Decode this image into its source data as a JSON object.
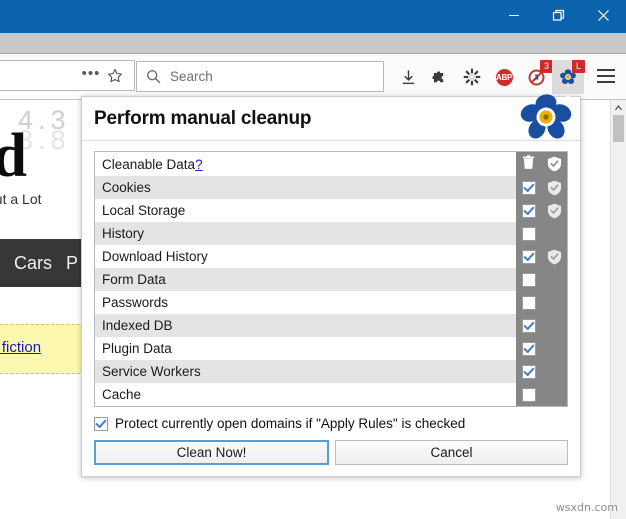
{
  "window": {
    "controls": [
      {
        "name": "minimize",
        "glyph": "minimize-icon"
      },
      {
        "name": "restore",
        "glyph": "restore-icon"
      },
      {
        "name": "close",
        "glyph": "close-icon"
      }
    ],
    "titlebar_color": "#0b63ad"
  },
  "toolbar": {
    "overflow_label": "•••",
    "search": {
      "placeholder": "Search",
      "value": ""
    },
    "icons": [
      {
        "name": "downloads-icon",
        "badge": ""
      },
      {
        "name": "extension-icon",
        "badge": ""
      },
      {
        "name": "settings-gear-icon",
        "badge": ""
      },
      {
        "name": "adblock-plus-icon",
        "label": "ABP",
        "badge": ""
      },
      {
        "name": "noscript-icon",
        "badge": "3"
      },
      {
        "name": "cookie-autodelete-icon",
        "badge": "L"
      }
    ],
    "menu_label": "menu"
  },
  "page": {
    "rating_top": "4.3",
    "rating_bottom": "3.8",
    "heading": "ed",
    "subheading": "out a Lot",
    "nav_items": [
      "Cars",
      "P"
    ],
    "highlight_link": "nd fiction"
  },
  "scrollbar": {
    "up_arrow": "scroll-up-arrow",
    "thumb_position": "top"
  },
  "dialog": {
    "title": "Perform manual cleanup",
    "logo": "forget-me-not-flower-logo",
    "table": {
      "header": {
        "label": "Cleanable Data",
        "help_link": "?",
        "col_clean": "trash-icon",
        "col_protect": "shield-icon"
      },
      "rows": [
        {
          "label": "Cookies",
          "checked": true,
          "shield": true
        },
        {
          "label": "Local Storage",
          "checked": true,
          "shield": true
        },
        {
          "label": "History",
          "checked": false,
          "shield": false
        },
        {
          "label": "Download History",
          "checked": true,
          "shield": true
        },
        {
          "label": "Form Data",
          "checked": false,
          "shield": false
        },
        {
          "label": "Passwords",
          "checked": false,
          "shield": false
        },
        {
          "label": "Indexed DB",
          "checked": true,
          "shield": false
        },
        {
          "label": "Plugin Data",
          "checked": true,
          "shield": false
        },
        {
          "label": "Service Workers",
          "checked": true,
          "shield": false
        },
        {
          "label": "Cache",
          "checked": false,
          "shield": false
        }
      ]
    },
    "protect_option": {
      "label": "Protect currently open domains if \"Apply Rules\" is checked",
      "checked": true
    },
    "buttons": {
      "primary": "Clean Now!",
      "secondary": "Cancel"
    }
  },
  "watermark": "wsxdn.com",
  "colors": {
    "titlebar": "#0b63ad",
    "table_header_bg": "#868686",
    "row_alt_bg": "#e4e4e4",
    "check_blue": "#3c7fd0",
    "focus_border": "#5a9cd8",
    "badge_red": "#cf2a2a"
  }
}
